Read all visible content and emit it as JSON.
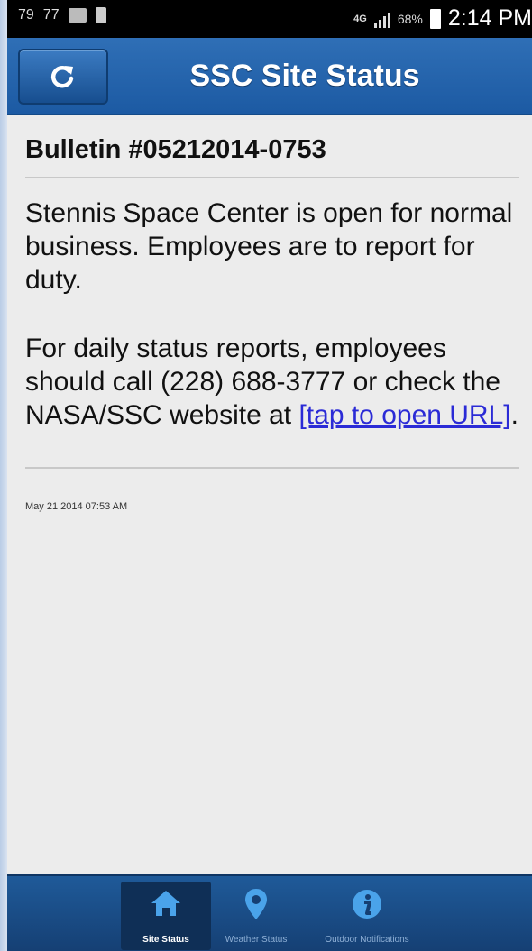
{
  "status_bar": {
    "left_icons": [
      "79",
      "77"
    ],
    "network": "4G",
    "battery": "68%",
    "time": "2:14 PM"
  },
  "header": {
    "title": "SSC Site Status",
    "refresh_icon": "refresh-icon"
  },
  "bulletin": {
    "title": "Bulletin #05212014-0753",
    "paragraph1": "Stennis Space Center is open for normal business. Employees are to report for duty.",
    "paragraph2_text": "For daily status reports, employees should call (228) 688-3777 or check the NASA/SSC website at ",
    "link_text": "[tap to open URL]",
    "paragraph2_end": ".",
    "timestamp": "May 21 2014 07:53 AM"
  },
  "bottom_nav": {
    "items": [
      {
        "label": "Site Status",
        "icon": "home-icon",
        "active": true
      },
      {
        "label": "Weather Status",
        "icon": "location-pin-icon",
        "active": false
      },
      {
        "label": "Outdoor Notifications",
        "icon": "info-icon",
        "active": false
      }
    ]
  },
  "colors": {
    "header_blue": "#1c5aa3",
    "nav_blue": "#153f73",
    "link": "#2b2bd6"
  }
}
